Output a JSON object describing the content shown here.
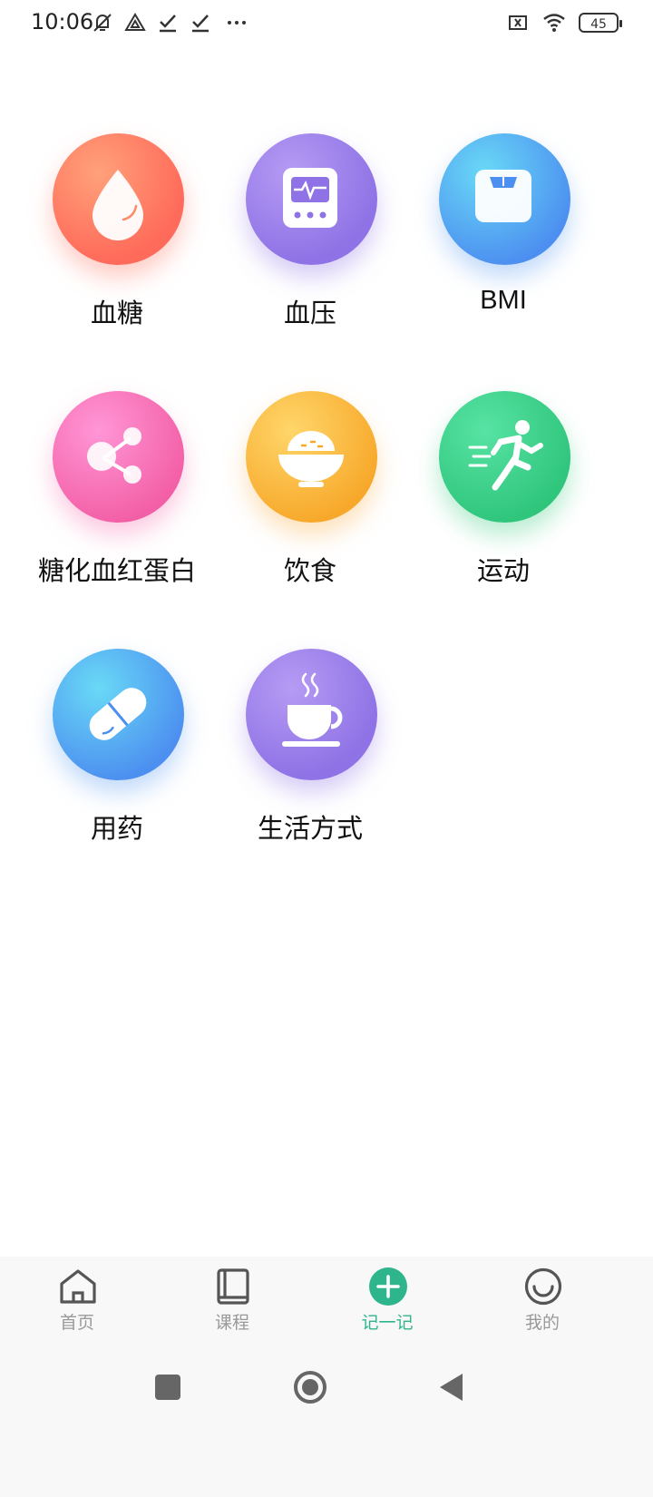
{
  "status_bar": {
    "time": "10:06",
    "battery": "45",
    "icons": [
      "mute-icon",
      "app-icon",
      "download-done-icon",
      "download-done-icon",
      "more-dots-icon",
      "sim-off-icon",
      "wifi-icon",
      "battery-icon"
    ]
  },
  "grid": {
    "items": [
      {
        "label": "血糖",
        "icon": "blood-drop-icon",
        "color": "#ff6b5a"
      },
      {
        "label": "血压",
        "icon": "blood-pressure-monitor-icon",
        "color": "#8f73e6"
      },
      {
        "label": "BMI",
        "icon": "scale-icon",
        "color": "#4c8ff0"
      },
      {
        "label": "糖化血红蛋白",
        "icon": "molecule-icon",
        "color": "#f35fa6"
      },
      {
        "label": "饮食",
        "icon": "rice-bowl-icon",
        "color": "#f7a82a"
      },
      {
        "label": "运动",
        "icon": "running-icon",
        "color": "#2fc57b"
      },
      {
        "label": "用药",
        "icon": "pill-icon",
        "color": "#4c8ff0"
      },
      {
        "label": "生活方式",
        "icon": "coffee-cup-icon",
        "color": "#8f73e6"
      }
    ]
  },
  "tab_bar": {
    "tabs": [
      {
        "label": "首页",
        "icon": "home-icon",
        "active": false
      },
      {
        "label": "课程",
        "icon": "book-icon",
        "active": false
      },
      {
        "label": "记一记",
        "icon": "add-circle-icon",
        "active": true
      },
      {
        "label": "我的",
        "icon": "smile-icon",
        "active": false
      }
    ],
    "active_color": "#2fb58c",
    "inactive_color": "#999999"
  },
  "nav_bar": {
    "buttons": [
      "recents-icon",
      "home-circle-icon",
      "back-icon"
    ]
  }
}
